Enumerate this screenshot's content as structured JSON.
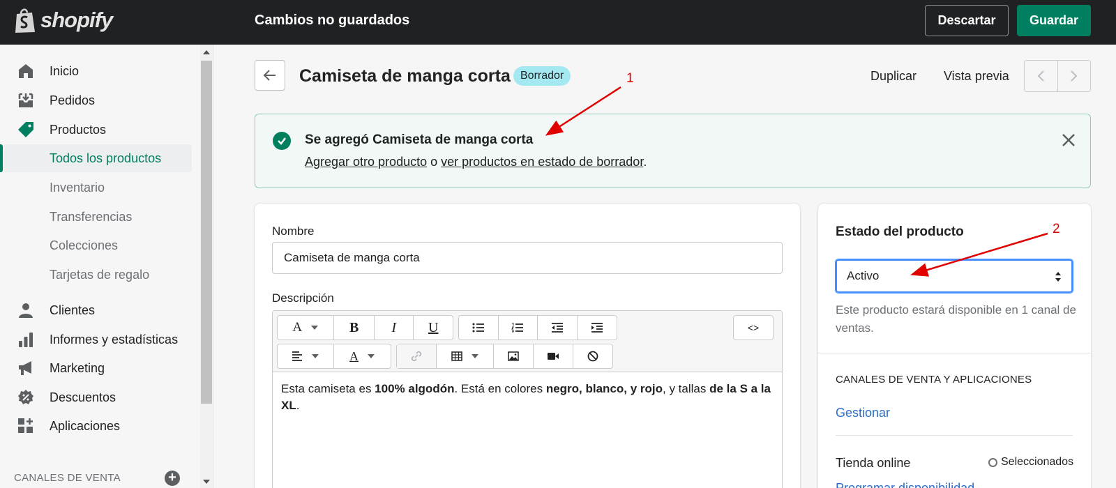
{
  "topbar": {
    "logo_text": "shopify",
    "unsaved_label": "Cambios no guardados",
    "discard_label": "Descartar",
    "save_label": "Guardar"
  },
  "sidebar": {
    "items": [
      {
        "label": "Inicio",
        "icon": "home-icon"
      },
      {
        "label": "Pedidos",
        "icon": "orders-icon"
      },
      {
        "label": "Productos",
        "icon": "tag-icon"
      },
      {
        "label": "Clientes",
        "icon": "person-icon"
      },
      {
        "label": "Informes y estadísticas",
        "icon": "bar-chart-icon"
      },
      {
        "label": "Marketing",
        "icon": "megaphone-icon"
      },
      {
        "label": "Descuentos",
        "icon": "discount-icon"
      },
      {
        "label": "Aplicaciones",
        "icon": "apps-icon"
      }
    ],
    "product_subitems": [
      "Todos los productos",
      "Inventario",
      "Transferencias",
      "Colecciones",
      "Tarjetas de regalo"
    ],
    "channels_label": "CANALES DE VENTA"
  },
  "header": {
    "title": "Camiseta de manga corta",
    "badge": "Borrador",
    "duplicate_label": "Duplicar",
    "preview_label": "Vista previa"
  },
  "banner": {
    "title": "Se agregó Camiseta de manga corta",
    "link1": "Agregar otro producto",
    "connector": " o ",
    "link2": "ver productos en estado de borrador",
    "end": "."
  },
  "product_form": {
    "name_label": "Nombre",
    "name_value": "Camiseta de manga corta",
    "description_label": "Descripción",
    "description": {
      "p1": "Esta camiseta es ",
      "b1": "100% algodón",
      "p2": ". Está en colores ",
      "b2": "negro, blanco, y rojo",
      "p3": ", y tallas ",
      "b3": "de la S a la XL",
      "p4": "."
    },
    "code_toggle": "<>"
  },
  "status_card": {
    "title": "Estado del producto",
    "selected": "Activo",
    "help": "Este producto estará disponible en 1 canal de ventas.",
    "section_title": "CANALES DE VENTA Y APLICACIONES",
    "manage_label": "Gestionar",
    "store_label": "Tienda online",
    "store_status": "Seleccionados",
    "schedule_label": "Programar disponibilidad"
  },
  "annotations": [
    "1",
    "2"
  ],
  "colors": {
    "topbar_bg": "#202123",
    "primary": "#008060",
    "badge_bg": "#a4e8f2",
    "link": "#2c6ecb",
    "annotation": "#e00000"
  }
}
